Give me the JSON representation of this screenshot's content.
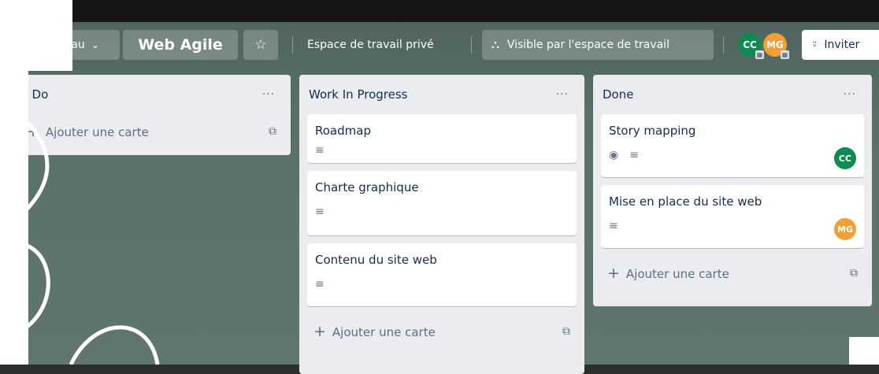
{
  "header": {
    "view_label": "Tableau",
    "board_title": "Web Agile",
    "workspace_label": "Espace de travail privé",
    "visibility_label": "Visible par l'espace de travail",
    "invite_label": "Inviter",
    "members": [
      {
        "initials": "CC",
        "color": "#0e8a52"
      },
      {
        "initials": "MG",
        "color": "#f2a033"
      }
    ]
  },
  "lists": [
    {
      "title": "To Do",
      "menu": "···",
      "cards": [],
      "add_label": "Ajouter une carte"
    },
    {
      "title": "Work In Progress",
      "menu": "···",
      "cards": [
        {
          "title": "Roadmap"
        },
        {
          "title": "Charte graphique"
        },
        {
          "title": "Contenu du site web"
        }
      ],
      "add_label": "Ajouter une carte"
    },
    {
      "title": "Done",
      "menu": "···",
      "cards": [
        {
          "title": "Story mapping",
          "member": "CC",
          "member_color": "#0e8a52",
          "watch": true
        },
        {
          "title": "Mise en place du site web",
          "member": "MG",
          "member_color": "#f2a033"
        }
      ],
      "add_label": "Ajouter une carte"
    }
  ]
}
